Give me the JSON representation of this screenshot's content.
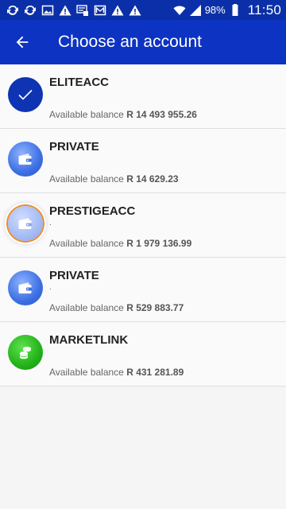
{
  "status_bar": {
    "left_icons": [
      "sync-icon",
      "sync-icon",
      "image-icon",
      "warning-icon",
      "voicemail-icon",
      "photo-icon",
      "warning-icon",
      "warning-icon"
    ],
    "battery_text": "98%",
    "time": "11:50"
  },
  "appbar": {
    "back_icon": "arrow-left-icon",
    "title": "Choose an account"
  },
  "accounts": [
    {
      "name": "ELITEACC",
      "subtitle": "",
      "balance_label": "Available balance",
      "balance": "R 14 493 955.26",
      "icon": "check-icon",
      "selected": true
    },
    {
      "name": "PRIVATE",
      "subtitle": "",
      "balance_label": "Available balance",
      "balance": "R 14 629.23",
      "icon": "wallet-icon",
      "selected": false
    },
    {
      "name": "PRESTIGEACC",
      "subtitle": ".",
      "balance_label": "Available balance",
      "balance": "R 1 979 136.99",
      "icon": "wallet-icon",
      "selected": false
    },
    {
      "name": "PRIVATE",
      "subtitle": ".",
      "balance_label": "Available balance",
      "balance": "R 529 883.77",
      "icon": "wallet-icon",
      "selected": false
    },
    {
      "name": "MARKETLINK",
      "subtitle": "",
      "balance_label": "Available balance",
      "balance": "R 431 281.89",
      "icon": "coins-icon",
      "selected": false
    }
  ]
}
